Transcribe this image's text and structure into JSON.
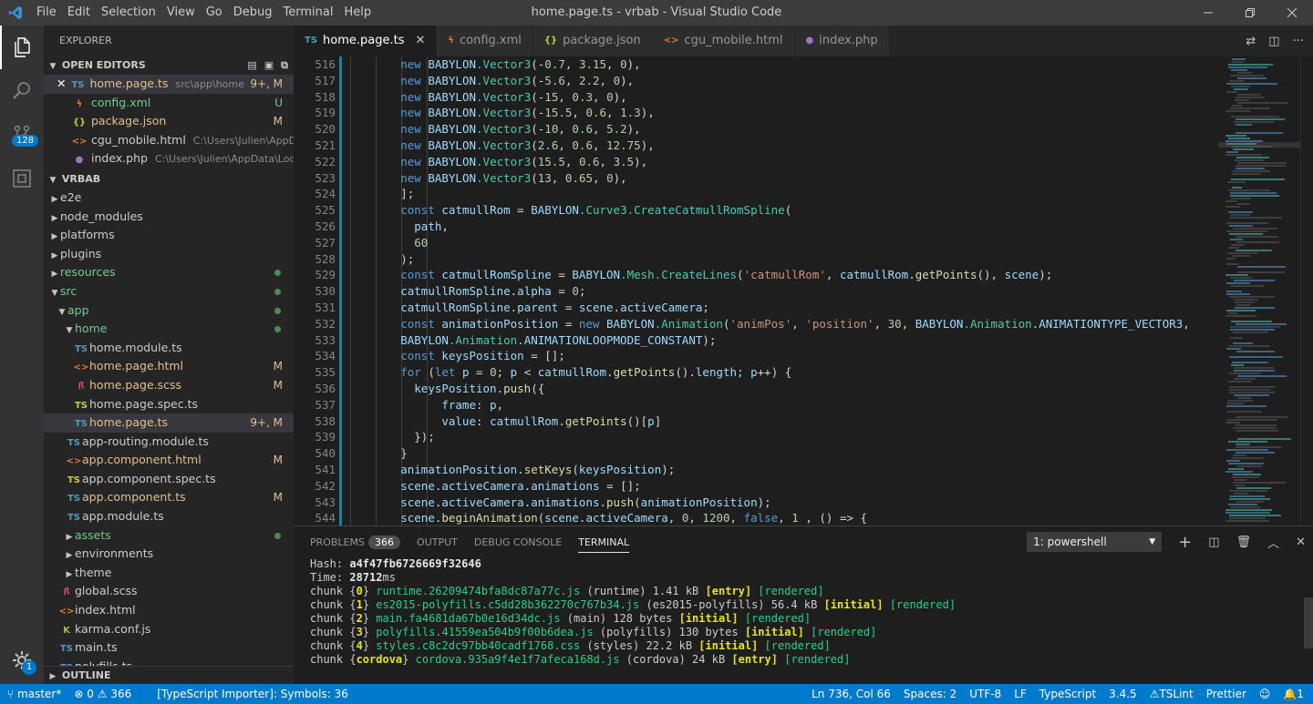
{
  "window": {
    "title": "home.page.ts - vrbab - Visual Studio Code",
    "menu": [
      "File",
      "Edit",
      "Selection",
      "View",
      "Go",
      "Debug",
      "Terminal",
      "Help"
    ]
  },
  "activity": {
    "scm_badge": "128",
    "settings_badge": "1"
  },
  "sidebar": {
    "header": "EXPLORER",
    "open_editors_title": "OPEN EDITORS",
    "open_editors": [
      {
        "icon": "TS",
        "name": "home.page.ts",
        "path": "src\\app\\home",
        "status": "9+, M"
      },
      {
        "icon": "xml",
        "name": "config.xml",
        "path": "",
        "status": "U"
      },
      {
        "icon": "{}",
        "name": "package.json",
        "path": "",
        "status": "M"
      },
      {
        "icon": "<>",
        "name": "cgu_mobile.html",
        "path": "C:\\Users\\Julien\\AppData...",
        "status": ""
      },
      {
        "icon": "php",
        "name": "index.php",
        "path": "C:\\Users\\Julien\\AppData\\Local\\...",
        "status": ""
      }
    ],
    "project_title": "VRBAB",
    "tree": [
      {
        "name": "e2e",
        "kind": "folder"
      },
      {
        "name": "node_modules",
        "kind": "folder"
      },
      {
        "name": "platforms",
        "kind": "folder"
      },
      {
        "name": "plugins",
        "kind": "folder"
      },
      {
        "name": "resources",
        "kind": "folder"
      },
      {
        "name": "src",
        "kind": "folder"
      },
      {
        "name": "app",
        "kind": "folder"
      },
      {
        "name": "home",
        "kind": "folder"
      },
      {
        "name": "home.module.ts",
        "kind": "file"
      },
      {
        "name": "home.page.html",
        "kind": "file",
        "status": "M"
      },
      {
        "name": "home.page.scss",
        "kind": "file",
        "status": "M"
      },
      {
        "name": "home.page.spec.ts",
        "kind": "file"
      },
      {
        "name": "home.page.ts",
        "kind": "file",
        "status": "9+, M"
      },
      {
        "name": "app-routing.module.ts",
        "kind": "file"
      },
      {
        "name": "app.component.html",
        "kind": "file",
        "status": "M"
      },
      {
        "name": "app.component.spec.ts",
        "kind": "file"
      },
      {
        "name": "app.component.ts",
        "kind": "file",
        "status": "M"
      },
      {
        "name": "app.module.ts",
        "kind": "file"
      },
      {
        "name": "assets",
        "kind": "folder"
      },
      {
        "name": "environments",
        "kind": "folder"
      },
      {
        "name": "theme",
        "kind": "folder"
      },
      {
        "name": "global.scss",
        "kind": "file"
      },
      {
        "name": "index.html",
        "kind": "file"
      },
      {
        "name": "karma.conf.js",
        "kind": "file"
      },
      {
        "name": "main.ts",
        "kind": "file"
      },
      {
        "name": "polyfills.ts",
        "kind": "file"
      }
    ],
    "outline_title": "OUTLINE"
  },
  "tabs": [
    {
      "icon": "TS",
      "label": "home.page.ts",
      "active": true
    },
    {
      "icon": "xml",
      "label": "config.xml"
    },
    {
      "icon": "{}",
      "label": "package.json"
    },
    {
      "icon": "<>",
      "label": "cgu_mobile.html"
    },
    {
      "icon": "php",
      "label": "index.php"
    }
  ],
  "editor": {
    "line_numbers": [
      "516",
      "517",
      "518",
      "519",
      "520",
      "521",
      "522",
      "523",
      "524",
      "525",
      "526",
      "527",
      "528",
      "529",
      "530",
      "531",
      "532",
      "533",
      "534",
      "535",
      "536",
      "537",
      "538",
      "539",
      "540",
      "541",
      "542",
      "543",
      "544"
    ],
    "lines": [
      "        new BABYLON.Vector3(-0.7, 3.15, 0),",
      "        new BABYLON.Vector3(-5.6, 2.2, 0),",
      "        new BABYLON.Vector3(-15, 0.3, 0),",
      "        new BABYLON.Vector3(-15.5, 0.6, 1.3),",
      "        new BABYLON.Vector3(-10, 0.6, 5.2),",
      "        new BABYLON.Vector3(2.6, 0.6, 12.75),",
      "        new BABYLON.Vector3(15.5, 0.6, 3.5),",
      "        new BABYLON.Vector3(13, 0.65, 0),",
      "        ];",
      "        const catmullRom = BABYLON.Curve3.CreateCatmullRomSpline(",
      "          path,",
      "          60",
      "        );",
      "        const catmullRomSpline = BABYLON.Mesh.CreateLines('catmullRom', catmullRom.getPoints(), scene);",
      "        catmullRomSpline.alpha = 0;",
      "        catmullRomSpline.parent = scene.activeCamera;",
      "        const animationPosition = new BABYLON.Animation('animPos', 'position', 30, BABYLON.Animation.ANIMATIONTYPE_VECTOR3,",
      "        BABYLON.Animation.ANIMATIONLOOPMODE_CONSTANT);",
      "        const keysPosition = [];",
      "        for (let p = 0; p < catmullRom.getPoints().length; p++) {",
      "          keysPosition.push({",
      "              frame: p,",
      "              value: catmullRom.getPoints()[p]",
      "          });",
      "        }",
      "        animationPosition.setKeys(keysPosition);",
      "        scene.activeCamera.animations = [];",
      "        scene.activeCamera.animations.push(animationPosition);",
      "        scene.beginAnimation(scene.activeCamera, 0, 1200, false, 1 , () => {"
    ]
  },
  "panel": {
    "tabs": [
      "PROBLEMS",
      "OUTPUT",
      "DEBUG CONSOLE",
      "TERMINAL"
    ],
    "problems_count": "366",
    "terminal_select": "1: powershell",
    "terminal_lines": [
      [
        {
          "t": "Hash: ",
          "c": ""
        },
        {
          "t": "a4f47fb6726669f32646",
          "c": "tw"
        }
      ],
      [
        {
          "t": "Time: ",
          "c": ""
        },
        {
          "t": "28712",
          "c": "tw"
        },
        {
          "t": "ms",
          "c": ""
        }
      ],
      [
        {
          "t": "chunk {",
          "c": ""
        },
        {
          "t": "0",
          "c": "ty"
        },
        {
          "t": "} ",
          "c": ""
        },
        {
          "t": "runtime.26209474bfa8dc87a77c.js",
          "c": "tg"
        },
        {
          "t": " (runtime) 1.41 kB ",
          "c": ""
        },
        {
          "t": "[entry]",
          "c": "ty"
        },
        {
          "t": " ",
          "c": ""
        },
        {
          "t": "[rendered]",
          "c": "tg"
        }
      ],
      [
        {
          "t": "chunk {",
          "c": ""
        },
        {
          "t": "1",
          "c": "ty"
        },
        {
          "t": "} ",
          "c": ""
        },
        {
          "t": "es2015-polyfills.c5dd28b362270c767b34.js",
          "c": "tg"
        },
        {
          "t": " (es2015-polyfills) 56.4 kB ",
          "c": ""
        },
        {
          "t": "[initial]",
          "c": "ty"
        },
        {
          "t": " ",
          "c": ""
        },
        {
          "t": "[rendered]",
          "c": "tg"
        }
      ],
      [
        {
          "t": "chunk {",
          "c": ""
        },
        {
          "t": "2",
          "c": "ty"
        },
        {
          "t": "} ",
          "c": ""
        },
        {
          "t": "main.fa4681da67b0e16d34dc.js",
          "c": "tg"
        },
        {
          "t": " (main) 128 bytes ",
          "c": ""
        },
        {
          "t": "[initial]",
          "c": "ty"
        },
        {
          "t": " ",
          "c": ""
        },
        {
          "t": "[rendered]",
          "c": "tg"
        }
      ],
      [
        {
          "t": "chunk {",
          "c": ""
        },
        {
          "t": "3",
          "c": "ty"
        },
        {
          "t": "} ",
          "c": ""
        },
        {
          "t": "polyfills.41559ea504b9f00b6dea.js",
          "c": "tg"
        },
        {
          "t": " (polyfills) 130 bytes ",
          "c": ""
        },
        {
          "t": "[initial]",
          "c": "ty"
        },
        {
          "t": " ",
          "c": ""
        },
        {
          "t": "[rendered]",
          "c": "tg"
        }
      ],
      [
        {
          "t": "chunk {",
          "c": ""
        },
        {
          "t": "4",
          "c": "ty"
        },
        {
          "t": "} ",
          "c": ""
        },
        {
          "t": "styles.c8c2dc97bb40cadf1768.css",
          "c": "tg"
        },
        {
          "t": " (styles) 22.2 kB ",
          "c": ""
        },
        {
          "t": "[initial]",
          "c": "ty"
        },
        {
          "t": " ",
          "c": ""
        },
        {
          "t": "[rendered]",
          "c": "tg"
        }
      ],
      [
        {
          "t": "chunk {",
          "c": ""
        },
        {
          "t": "cordova",
          "c": "ty"
        },
        {
          "t": "} ",
          "c": ""
        },
        {
          "t": "cordova.935a9f4e1f7afeca168d.js",
          "c": "tg"
        },
        {
          "t": " (cordova) 24 kB ",
          "c": ""
        },
        {
          "t": "[entry]",
          "c": "ty"
        },
        {
          "t": " ",
          "c": ""
        },
        {
          "t": "[rendered]",
          "c": "tg"
        }
      ]
    ]
  },
  "status": {
    "branch": "master*",
    "errors": "0",
    "warnings": "366",
    "importer": "[TypeScript Importer]: Symbols: 36",
    "position": "Ln 736, Col 66",
    "spaces": "Spaces: 2",
    "encoding": "UTF-8",
    "eol": "LF",
    "language": "TypeScript",
    "ts_version": "3.4.5",
    "tslint": "TSLint",
    "prettier": "Prettier",
    "notifications": "1"
  },
  "colors": {
    "accent": "#007acc",
    "titlebar": "#3c3c3c",
    "sidebar": "#252526",
    "editor": "#1e1e1e"
  }
}
